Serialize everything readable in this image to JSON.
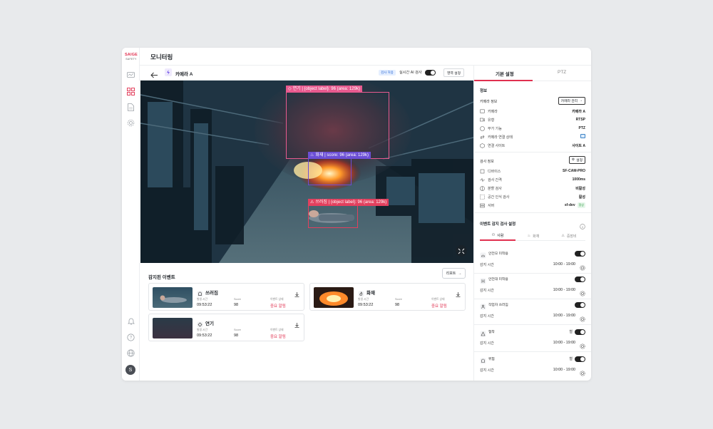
{
  "app": {
    "brand": "SAIGE",
    "brand_sub": "SAFETY",
    "page_title": "모니터링",
    "avatar": "S"
  },
  "camera": {
    "name": "카메라 A",
    "badge": "검사 허용",
    "realtime_label": "실시간 AI 검사",
    "area_button": "영역 설정",
    "detections": [
      {
        "label": "연기 | {object label}: 96 (area: 129k)",
        "color": "#e85a8f"
      },
      {
        "label": "화재 | score: 96 (area: 129k)",
        "color": "#6c4fd6"
      },
      {
        "label": "쓰러짐 | {object label}: 96 (area: 129k)",
        "color": "#e2405e"
      }
    ]
  },
  "events": {
    "title": "감지된 이벤트",
    "report_button": "리포트",
    "items": [
      {
        "name": "쓰러짐",
        "k1": "발생 시간",
        "v1": "09:53:22",
        "k2": "Score",
        "v2": "98",
        "k3": "이벤트 상태",
        "v3": "중요 알림"
      },
      {
        "name": "화재",
        "k1": "발생 시간",
        "v1": "09:53:22",
        "k2": "Score",
        "v2": "98",
        "k3": "이벤트 상태",
        "v3": "중요 알림"
      },
      {
        "name": "연기",
        "k1": "발생 시간",
        "v1": "09:53:22",
        "k2": "Score",
        "v2": "98",
        "k3": "이벤트 상태",
        "v3": "중요 알림"
      }
    ]
  },
  "panel": {
    "tabs": [
      "기본 설정",
      "PTZ"
    ],
    "info_title": "정보",
    "camera_info_label": "카메라 정보",
    "camera_manage_button": "카메라 관리",
    "camera_rows": [
      {
        "k": "카메라",
        "v": "카메라 A"
      },
      {
        "k": "유형",
        "v": "RTSP"
      },
      {
        "k": "부가 기능",
        "v": "PTZ"
      },
      {
        "k": "카메라 연결 상태",
        "v": ""
      },
      {
        "k": "연결 사이트",
        "v": "사이트 A"
      }
    ],
    "inspect_info_label": "검사 정보",
    "settings_button": "설정",
    "inspect_rows": [
      {
        "k": "디바이스",
        "v": "SF-CAM-PRO"
      },
      {
        "k": "검사 간격",
        "v": "1000ms"
      },
      {
        "k": "분할 검사",
        "v": "비활성"
      },
      {
        "k": "공간 인식 검사",
        "v": "활성"
      },
      {
        "k": "서버",
        "v": "sf-dev",
        "badge": "정상"
      }
    ],
    "event_settings_title": "이벤트 감지 검사 설정",
    "subtabs": [
      "사람",
      "화재",
      "중장비"
    ],
    "detect_items": [
      {
        "name": "안전모 미착용",
        "time_label": "감지 시간",
        "time": "10:00 - 19:00",
        "extra": ""
      },
      {
        "name": "안전대 미착용",
        "time_label": "감지 시간",
        "time": "10:00 - 19:00",
        "extra": ""
      },
      {
        "name": "작업자 쓰러짐",
        "time_label": "감지 시간",
        "time": "10:00 - 19:00",
        "extra": ""
      },
      {
        "name": "협착",
        "time_label": "감지 시간",
        "time": "10:00 - 19:00",
        "extra": "철"
      },
      {
        "name": "위험",
        "time_label": "감지 시간",
        "time": "10:00 - 19:00",
        "extra": "철"
      }
    ]
  },
  "colors": {
    "accent": "#e0304f",
    "fire": "#6c4fd6",
    "smoke": "#e85a8f",
    "fall": "#e2405e"
  }
}
